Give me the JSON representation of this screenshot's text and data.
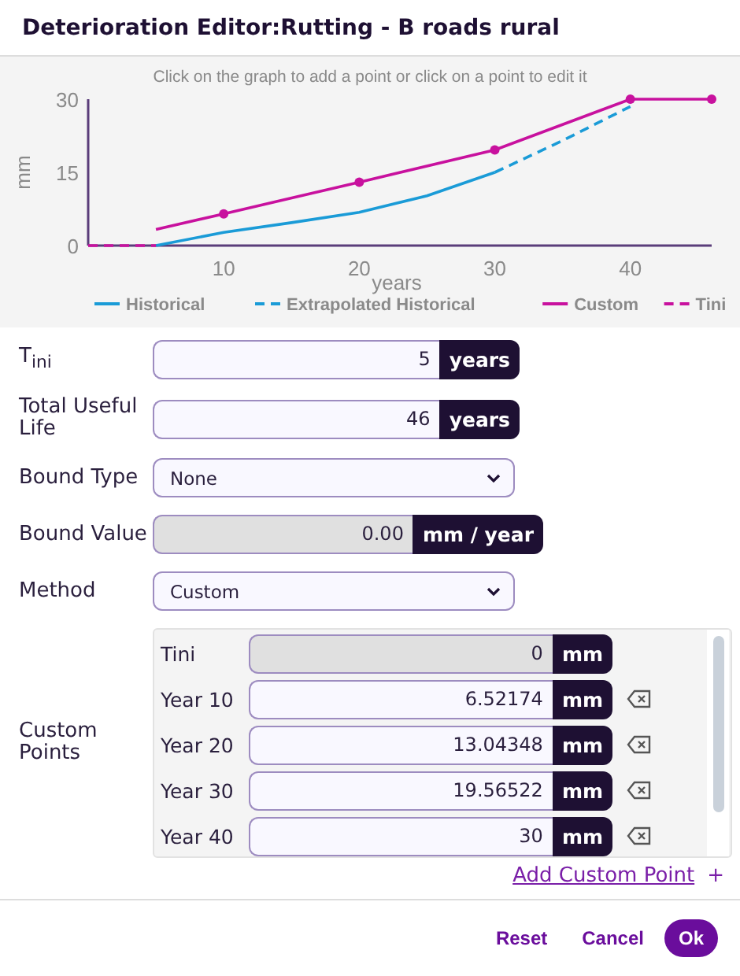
{
  "window": {
    "title": "Deterioration Editor:Rutting - B roads rural"
  },
  "chart": {
    "hint": "Click on the graph to add a point or click on a point to edit it",
    "chart_data": {
      "type": "line",
      "xlabel": "years",
      "ylabel": "mm",
      "x": [
        0,
        5,
        10,
        15,
        20,
        25,
        30,
        35,
        40,
        46
      ],
      "xlim": [
        0,
        46
      ],
      "ylim": [
        0,
        30
      ],
      "xticks": [
        10,
        20,
        30,
        40
      ],
      "yticks": [
        0,
        15,
        30
      ],
      "legend": "bottom",
      "series": [
        {
          "name": "Historical",
          "color": "#1a9bd7",
          "line_style": "solid",
          "marker": "none",
          "values": [
            null,
            0,
            2.7,
            4.7,
            6.8,
            10.2,
            15,
            null,
            null,
            null
          ]
        },
        {
          "name": "Extrapolated Historical",
          "color": "#1a9bd7",
          "line_style": "dashed",
          "marker": "none",
          "values": [
            null,
            null,
            null,
            null,
            null,
            null,
            15,
            21.5,
            28.5,
            null
          ]
        },
        {
          "name": "Custom",
          "color": "#c8119e",
          "line_style": "solid",
          "marker": "circle",
          "values": [
            null,
            3.3,
            6.5,
            null,
            13,
            null,
            19.6,
            null,
            30,
            30
          ]
        },
        {
          "name": "Tini",
          "color": "#c8119e",
          "line_style": "dashed",
          "marker": "none",
          "values": [
            0,
            0,
            null,
            null,
            null,
            null,
            null,
            null,
            null,
            null
          ]
        }
      ]
    }
  },
  "fields": [
    {
      "kind": "number",
      "label": "T$_{ini}$",
      "value": "5",
      "unit": "years",
      "disabled": false
    },
    {
      "kind": "number",
      "label": "Total Useful Life",
      "value": "46",
      "unit": "years",
      "disabled": false
    },
    {
      "kind": "select",
      "label": "Bound Type",
      "value": "None"
    },
    {
      "kind": "number",
      "label": "Bound Value",
      "value": "0.00",
      "unit": "mm / year",
      "disabled": true
    },
    {
      "kind": "select",
      "label": "Method",
      "value": "Custom"
    }
  ],
  "custom_points": {
    "label": "Custom Points",
    "rows": [
      {
        "label": "Tini",
        "value": "0",
        "unit": "mm",
        "disabled": true,
        "removable": false
      },
      {
        "label": "Year 10",
        "value": "6.52174",
        "unit": "mm",
        "disabled": false,
        "removable": true
      },
      {
        "label": "Year 20",
        "value": "13.04348",
        "unit": "mm",
        "disabled": false,
        "removable": true
      },
      {
        "label": "Year 30",
        "value": "19.56522",
        "unit": "mm",
        "disabled": false,
        "removable": true
      },
      {
        "label": "Year 40",
        "value": "30",
        "unit": "mm",
        "disabled": false,
        "removable": true
      }
    ],
    "add_link": "Add Custom Point",
    "add_icon": "+"
  },
  "buttons": [
    {
      "label": "Reset",
      "primary": false
    },
    {
      "label": "Cancel",
      "primary": false
    },
    {
      "label": "Ok",
      "primary": true
    }
  ]
}
